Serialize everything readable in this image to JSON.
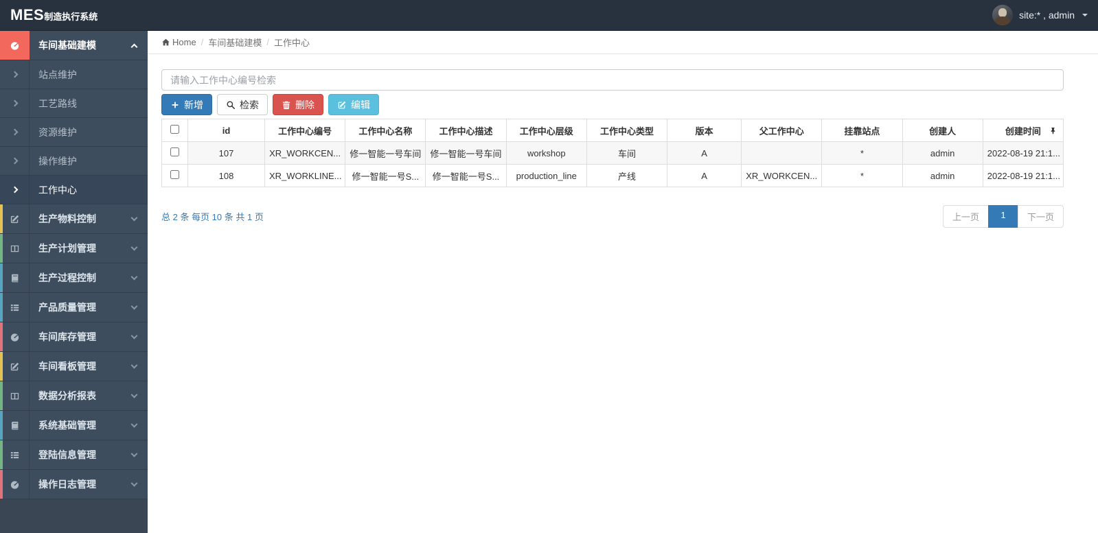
{
  "brand": {
    "bold": "MES",
    "rest": "制造执行系统"
  },
  "userbar": {
    "label": "site:* , admin"
  },
  "sidebar": {
    "group": {
      "label": "车间基础建模",
      "icon": "dashboard-icon",
      "icon_bg": "#f2685c",
      "expanded": true
    },
    "submenu": [
      {
        "label": "站点维护"
      },
      {
        "label": "工艺路线"
      },
      {
        "label": "资源维护"
      },
      {
        "label": "操作维护"
      },
      {
        "label": "工作中心",
        "active": true
      }
    ],
    "items": [
      {
        "label": "生产物料控制",
        "icon": "edit-icon",
        "strip": "#e3c152"
      },
      {
        "label": "生产计划管理",
        "icon": "columns-icon",
        "strip": "#76b583"
      },
      {
        "label": "生产过程控制",
        "icon": "book-icon",
        "strip": "#56a6c2"
      },
      {
        "label": "产品质量管理",
        "icon": "list-icon",
        "strip": "#56a6c2"
      },
      {
        "label": "车间库存管理",
        "icon": "dashboard-icon",
        "strip": "#e0737c"
      },
      {
        "label": "车间看板管理",
        "icon": "edit-icon",
        "strip": "#e3c152"
      },
      {
        "label": "数据分析报表",
        "icon": "columns-icon",
        "strip": "#76b583"
      },
      {
        "label": "系统基础管理",
        "icon": "book-icon",
        "strip": "#56a6c2"
      },
      {
        "label": "登陆信息管理",
        "icon": "list-icon",
        "strip": "#76b583"
      },
      {
        "label": "操作日志管理",
        "icon": "dashboard-icon",
        "strip": "#e0737c"
      }
    ]
  },
  "breadcrumb": {
    "home": "Home",
    "level1": "车间基础建模",
    "current": "工作中心",
    "separator": "/"
  },
  "toolbar": {
    "search_placeholder": "请输入工作中心编号检索",
    "add_label": "新增",
    "search_label": "检索",
    "delete_label": "删除",
    "edit_label": "编辑"
  },
  "table": {
    "columns": [
      "id",
      "工作中心编号",
      "工作中心名称",
      "工作中心描述",
      "工作中心层级",
      "工作中心类型",
      "版本",
      "父工作中心",
      "挂靠站点",
      "创建人",
      "创建时间"
    ],
    "rows": [
      {
        "cells": [
          "107",
          "XR_WORKCEN...",
          "修一智能一号车间",
          "修一智能一号车间",
          "workshop",
          "车间",
          "A",
          "",
          "*",
          "admin",
          "2022-08-19 21:1..."
        ]
      },
      {
        "cells": [
          "108",
          "XR_WORKLINE...",
          "修一智能一号S...",
          "修一智能一号S...",
          "production_line",
          "产线",
          "A",
          "XR_WORKCEN...",
          "*",
          "admin",
          "2022-08-19 21:1..."
        ]
      }
    ]
  },
  "pagination": {
    "summary": "总 2 条  每页 10 条  共 1 页",
    "prev": "上一页",
    "page": "1",
    "next": "下一页"
  },
  "icons": [
    "dashboard-icon",
    "edit-icon",
    "columns-icon",
    "book-icon",
    "list-icon",
    "home-icon",
    "plus-icon",
    "search-icon",
    "trash-icon",
    "pin-icon",
    "caret-down-icon",
    "chevron-icons"
  ],
  "colors": {
    "primary": "#337ab7",
    "danger": "#d9534f",
    "info": "#5bc0de",
    "navbar_bg": "#28323e",
    "sidebar_bg": "#3e4d5e",
    "group_icon_bg": "#f2685c"
  }
}
